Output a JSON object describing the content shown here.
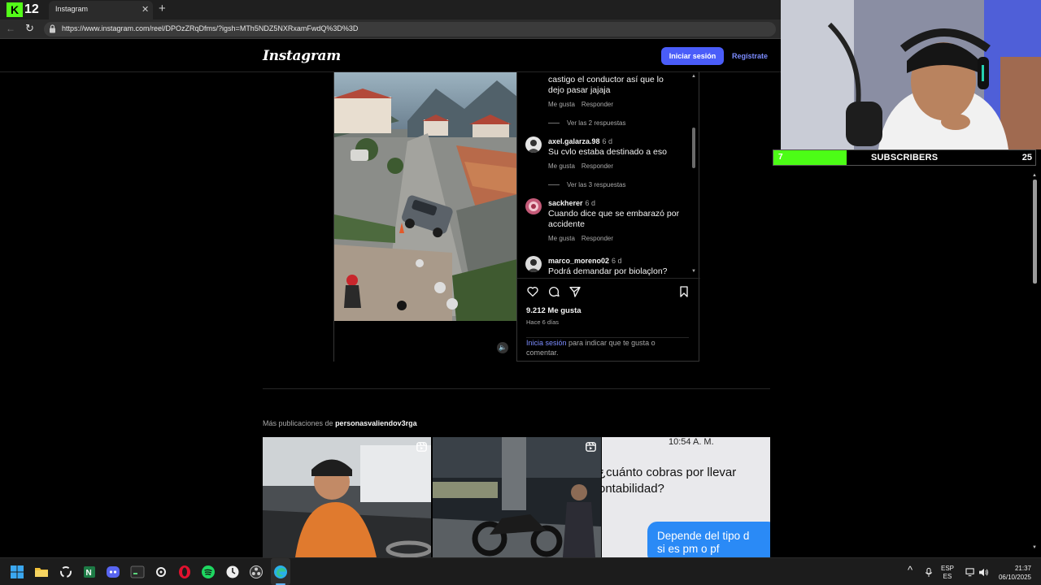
{
  "browser": {
    "kick_number": "12",
    "tab_title": "Instagram",
    "tab_close": "✕",
    "new_tab": "+",
    "back": "←",
    "reload": "↻",
    "url": "https://www.instagram.com/reel/DPOzZRqDfms/?igsh=MTh5NDZ5NXRxamFwdQ%3D%3D"
  },
  "header": {
    "logo": "Instagram",
    "login_button": "Iniciar sesión",
    "register_link": "Regístrate"
  },
  "comments": {
    "scroll_up": "▲",
    "scroll_down": "▼",
    "first_text_line1": "castigo el conductor así que lo",
    "first_text_line2": "dejo pasar jajaja",
    "like_label": "Me gusta",
    "reply_label": "Responder",
    "items": [
      {
        "username": "axel.galarza.98",
        "age": "6 d",
        "text": "Su cvlo estaba destinado a eso",
        "replies": "Ver las 2 respuestas"
      },
      {
        "username": "sackherer",
        "age": "6 d",
        "text_line1": "Cuando dice que se embarazó por",
        "text_line2": "accidente",
        "replies": "Ver las 3 respuestas"
      },
      {
        "username": "marco_moreno02",
        "age": "6 d",
        "text": "Podrá demandar por biolaçlon?"
      }
    ]
  },
  "post": {
    "mute_icon": "🔈",
    "likes": "9.212 Me gusta",
    "posted": "Hace 6 días",
    "login_link": "Inicia sesión",
    "login_rest": " para indicar que te gusta o comentar."
  },
  "more_posts": {
    "label": "Más publicaciones de ",
    "account": "personasvaliendov3rga",
    "thumb3_time": "10:54 A. M.",
    "thumb3_question": "¿cuánto cobras por llevar\nontabilidad?",
    "thumb3_reply": "Depende del tipo d\nsi es pm o pf"
  },
  "stream": {
    "sub_count": "7",
    "sub_label": "SUBSCRIBERS",
    "sub_goal": "25",
    "sub_fraction": 0.28
  },
  "taskbar": {
    "tray_arrow": "^",
    "lang_line1": "ESP",
    "lang_line2": "ES",
    "time": "21:37",
    "date": "06/10/2025"
  },
  "colors": {
    "accent": "#4a5df9",
    "link": "#7c8cff",
    "kick_green": "#53fc18",
    "sub_bar": "#4cfd16"
  }
}
